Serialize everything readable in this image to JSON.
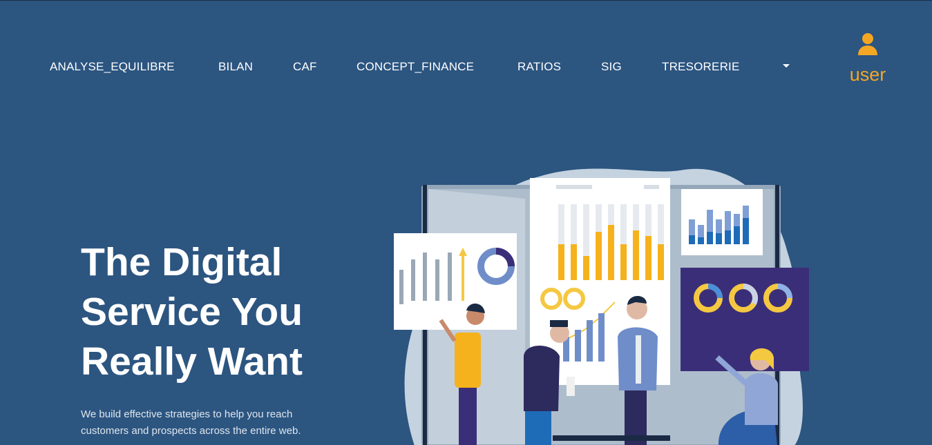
{
  "nav": {
    "items": [
      {
        "label": "ANALYSE_EQUILIBRE"
      },
      {
        "label": "BILAN"
      },
      {
        "label": "CAF"
      },
      {
        "label": "CONCEPT_FINANCE"
      },
      {
        "label": "RATIOS"
      },
      {
        "label": "SIG"
      },
      {
        "label": "TRESORERIE"
      }
    ],
    "dropdown_icon": "caret-down-icon"
  },
  "user": {
    "label": "user",
    "icon": "user-icon",
    "color": "#f5a623"
  },
  "hero": {
    "title_lines": [
      "The Digital",
      "Service You",
      "Really Want"
    ],
    "subtitle_lines": [
      "We build effective strategies to help you reach",
      "customers and prospects across the entire web."
    ]
  },
  "colors": {
    "background": "#2c5580",
    "accent": "#f5a623",
    "text": "#ffffff"
  }
}
